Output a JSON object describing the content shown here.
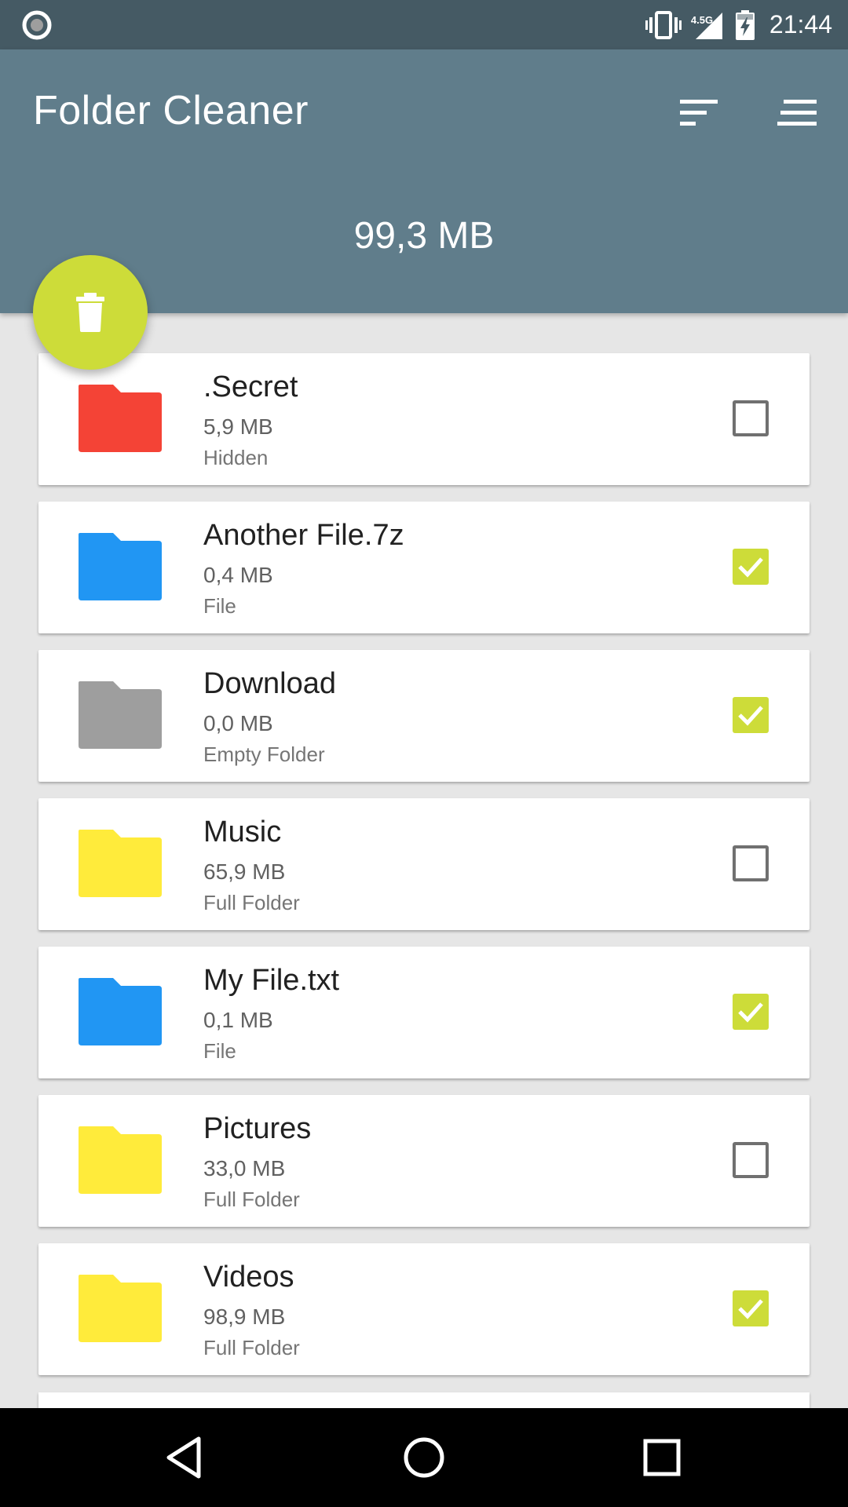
{
  "status_bar": {
    "time": "21:44",
    "network": "4.5G",
    "icons": [
      "record-icon",
      "vibrate-icon",
      "signal-icon",
      "battery-charging-icon"
    ]
  },
  "app_bar": {
    "title": "Folder Cleaner",
    "total_size": "99,3 MB",
    "actions": [
      "sort-icon",
      "menu-icon"
    ]
  },
  "fab": {
    "icon": "trash-icon",
    "color": "#CDDC39"
  },
  "items": [
    {
      "name": ".Secret",
      "size": "5,9 MB",
      "type": "Hidden",
      "color": "#F44336",
      "checked": false
    },
    {
      "name": "Another File.7z",
      "size": "0,4 MB",
      "type": "File",
      "color": "#2196F3",
      "checked": true
    },
    {
      "name": "Download",
      "size": "0,0 MB",
      "type": "Empty Folder",
      "color": "#9E9E9E",
      "checked": true
    },
    {
      "name": "Music",
      "size": "65,9 MB",
      "type": "Full Folder",
      "color": "#FFEB3B",
      "checked": false
    },
    {
      "name": "My File.txt",
      "size": "0,1 MB",
      "type": "File",
      "color": "#2196F3",
      "checked": true
    },
    {
      "name": "Pictures",
      "size": "33,0 MB",
      "type": "Full Folder",
      "color": "#FFEB3B",
      "checked": false
    },
    {
      "name": "Videos",
      "size": "98,9 MB",
      "type": "Full Folder",
      "color": "#FFEB3B",
      "checked": true
    }
  ],
  "colors": {
    "status_bar": "#455A64",
    "app_bar": "#607D8B",
    "accent": "#CDDC39",
    "background": "#E6E6E6"
  },
  "nav_bar": {
    "buttons": [
      "back-icon",
      "home-icon",
      "recents-icon"
    ]
  }
}
